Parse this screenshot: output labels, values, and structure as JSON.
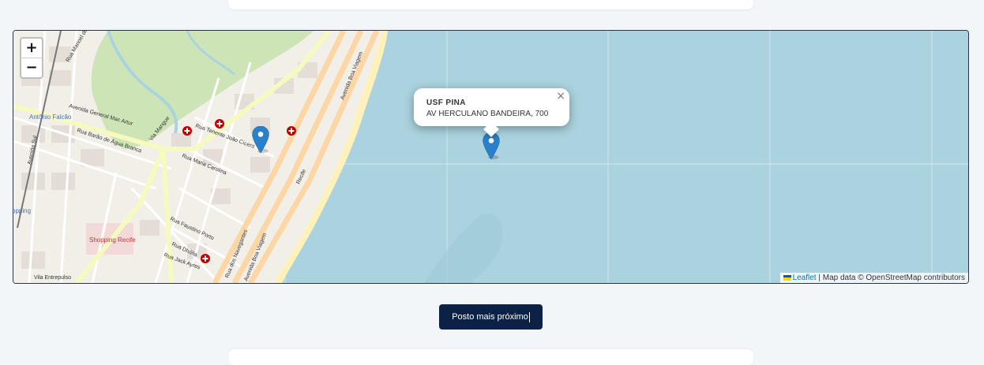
{
  "map": {
    "zoom_in_label": "+",
    "zoom_out_label": "−",
    "attribution": {
      "leaflet_link": "Leaflet",
      "separator": " | ",
      "text": "Map data © OpenStreetMap contributors"
    },
    "street_labels": [
      "Avenida General Mac Artur",
      "Rua Barão de Água Branca",
      "Via Mangue",
      "Rua Tenente João Cícero",
      "Rua Maria Carolina",
      "Rua Faustino Porto",
      "Rua Dhália",
      "Rua Jack Ayres",
      "Rua dos Navegantes",
      "Avenida Boa Viagem",
      "Rua Manoel de Brito",
      "Avenida Sul",
      "Recife",
      "Vila Entrepulso"
    ],
    "place_labels": [
      "Antônio Falcão",
      "Shopping Recife",
      "opping"
    ],
    "colors": {
      "water": "#aad3df",
      "land": "#f2efe9",
      "primary_road": "#fcd6a4",
      "secondary_road": "#f7fabf",
      "park": "#cde5b6",
      "marker": "#2a81cb",
      "hospital": "#bf0000"
    },
    "markers": [
      {
        "name": "user-location-marker"
      },
      {
        "name": "health-unit-marker"
      }
    ],
    "popup": {
      "name": "USF PINA",
      "address": "AV HERCULANO BANDEIRA, 700",
      "close_label": "×"
    }
  },
  "actions": {
    "nearest_button_label": "Posto mais próximo"
  }
}
